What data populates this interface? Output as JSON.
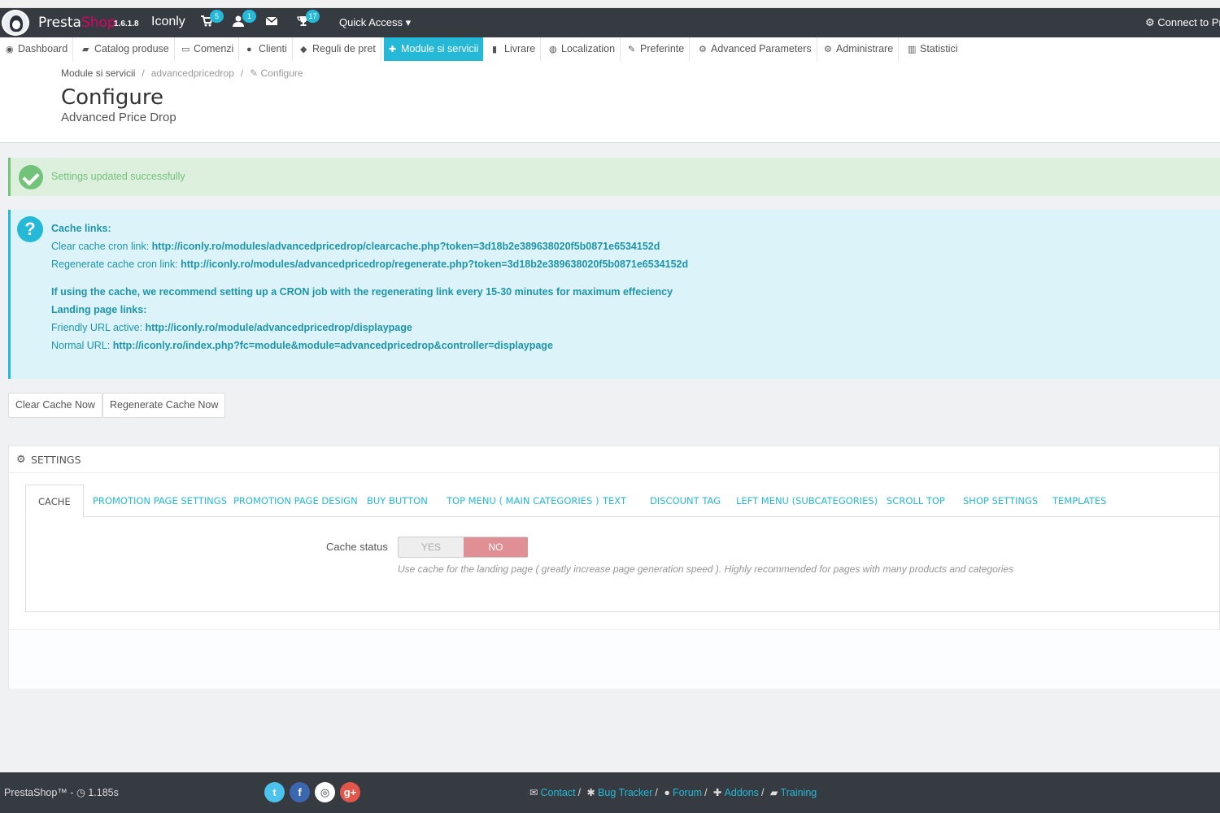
{
  "topbar": {
    "brand_presta": "Presta",
    "brand_shop": "Shop",
    "version": "1.6.1.8",
    "shop_name": "Iconly",
    "badges": {
      "orders": "5",
      "customers": "1",
      "messages": "",
      "trophy": "17"
    },
    "quick_access": "Quick Access ▾",
    "connect": "Connect to Pr"
  },
  "nav": {
    "items": [
      {
        "label": "Dashboard",
        "icon": "dashboard-icon"
      },
      {
        "label": "Catalog produse",
        "icon": "book-icon"
      },
      {
        "label": "Comenzi",
        "icon": "credit-card-icon"
      },
      {
        "label": "Clienti",
        "icon": "users-icon"
      },
      {
        "label": "Reguli de pret",
        "icon": "tags-icon"
      },
      {
        "label": "Module si servicii",
        "icon": "puzzle-icon"
      },
      {
        "label": "Livrare",
        "icon": "truck-icon"
      },
      {
        "label": "Localization",
        "icon": "globe-icon"
      },
      {
        "label": "Preferinte",
        "icon": "wrench-icon"
      },
      {
        "label": "Advanced Parameters",
        "icon": "cogs-icon"
      },
      {
        "label": "Administrare",
        "icon": "cog-icon"
      },
      {
        "label": "Statistici",
        "icon": "bar-chart-icon"
      }
    ],
    "active_index": 5
  },
  "header": {
    "breadcrumb": [
      "Module si servicii",
      "advancedpricedrop",
      "Configure"
    ],
    "title": "Configure",
    "subtitle": "Advanced Price Drop"
  },
  "success": {
    "text": "Settings updated successfully"
  },
  "info": {
    "cache_links_title": "Cache links:",
    "clear_label": "Clear cache cron link: ",
    "clear_link": "http://iconly.ro/modules/advancedpricedrop/clearcache.php?token=3d18b2e389638020f5b0871e6534152d",
    "regen_label": "Regenerate cache cron link: ",
    "regen_link": "http://iconly.ro/modules/advancedpricedrop/regenerate.php?token=3d18b2e389638020f5b0871e6534152d",
    "recommend": "If using the cache, we recommend setting up a CRON job with the regenerating link every 15-30 minutes for maximum effeciency",
    "landing_title": "Landing page links:",
    "friendly_label": "Friendly URL active: ",
    "friendly_link": "http://iconly.ro/module/advancedpricedrop/displaypage",
    "normal_label": "Normal URL: ",
    "normal_link": "http://iconly.ro/index.php?fc=module&module=advancedpricedrop&controller=displaypage"
  },
  "buttons": {
    "clear_cache": "Clear Cache Now",
    "regenerate_cache": "Regenerate Cache Now"
  },
  "settings": {
    "heading": "Settings",
    "tabs": [
      "Cache",
      "Promotion page settings",
      "Promotion page design",
      "Buy button",
      "Top menu ( main categories )",
      "Text",
      "Discount tag",
      "Left menu (subcategories)",
      "Scroll top",
      "Shop settings",
      "Templates"
    ],
    "cache_status_label": "Cache status",
    "yes": "YES",
    "no": "NO",
    "help": "Use cache for the landing page ( greatly increase page generation speed ). Highly recommended for pages with many products and categories"
  },
  "footer": {
    "left_brand": "PrestaShop™",
    "left_sep": " - ",
    "load_time": "1.185s",
    "links": [
      "Contact",
      "Bug Tracker",
      "Forum",
      "Addons",
      "Training"
    ]
  },
  "colors": {
    "accent": "#25b9d7",
    "topbar": "#363a41",
    "success": "#72c279",
    "no_switch": "#e08f95",
    "brand_shop": "#df0067"
  }
}
